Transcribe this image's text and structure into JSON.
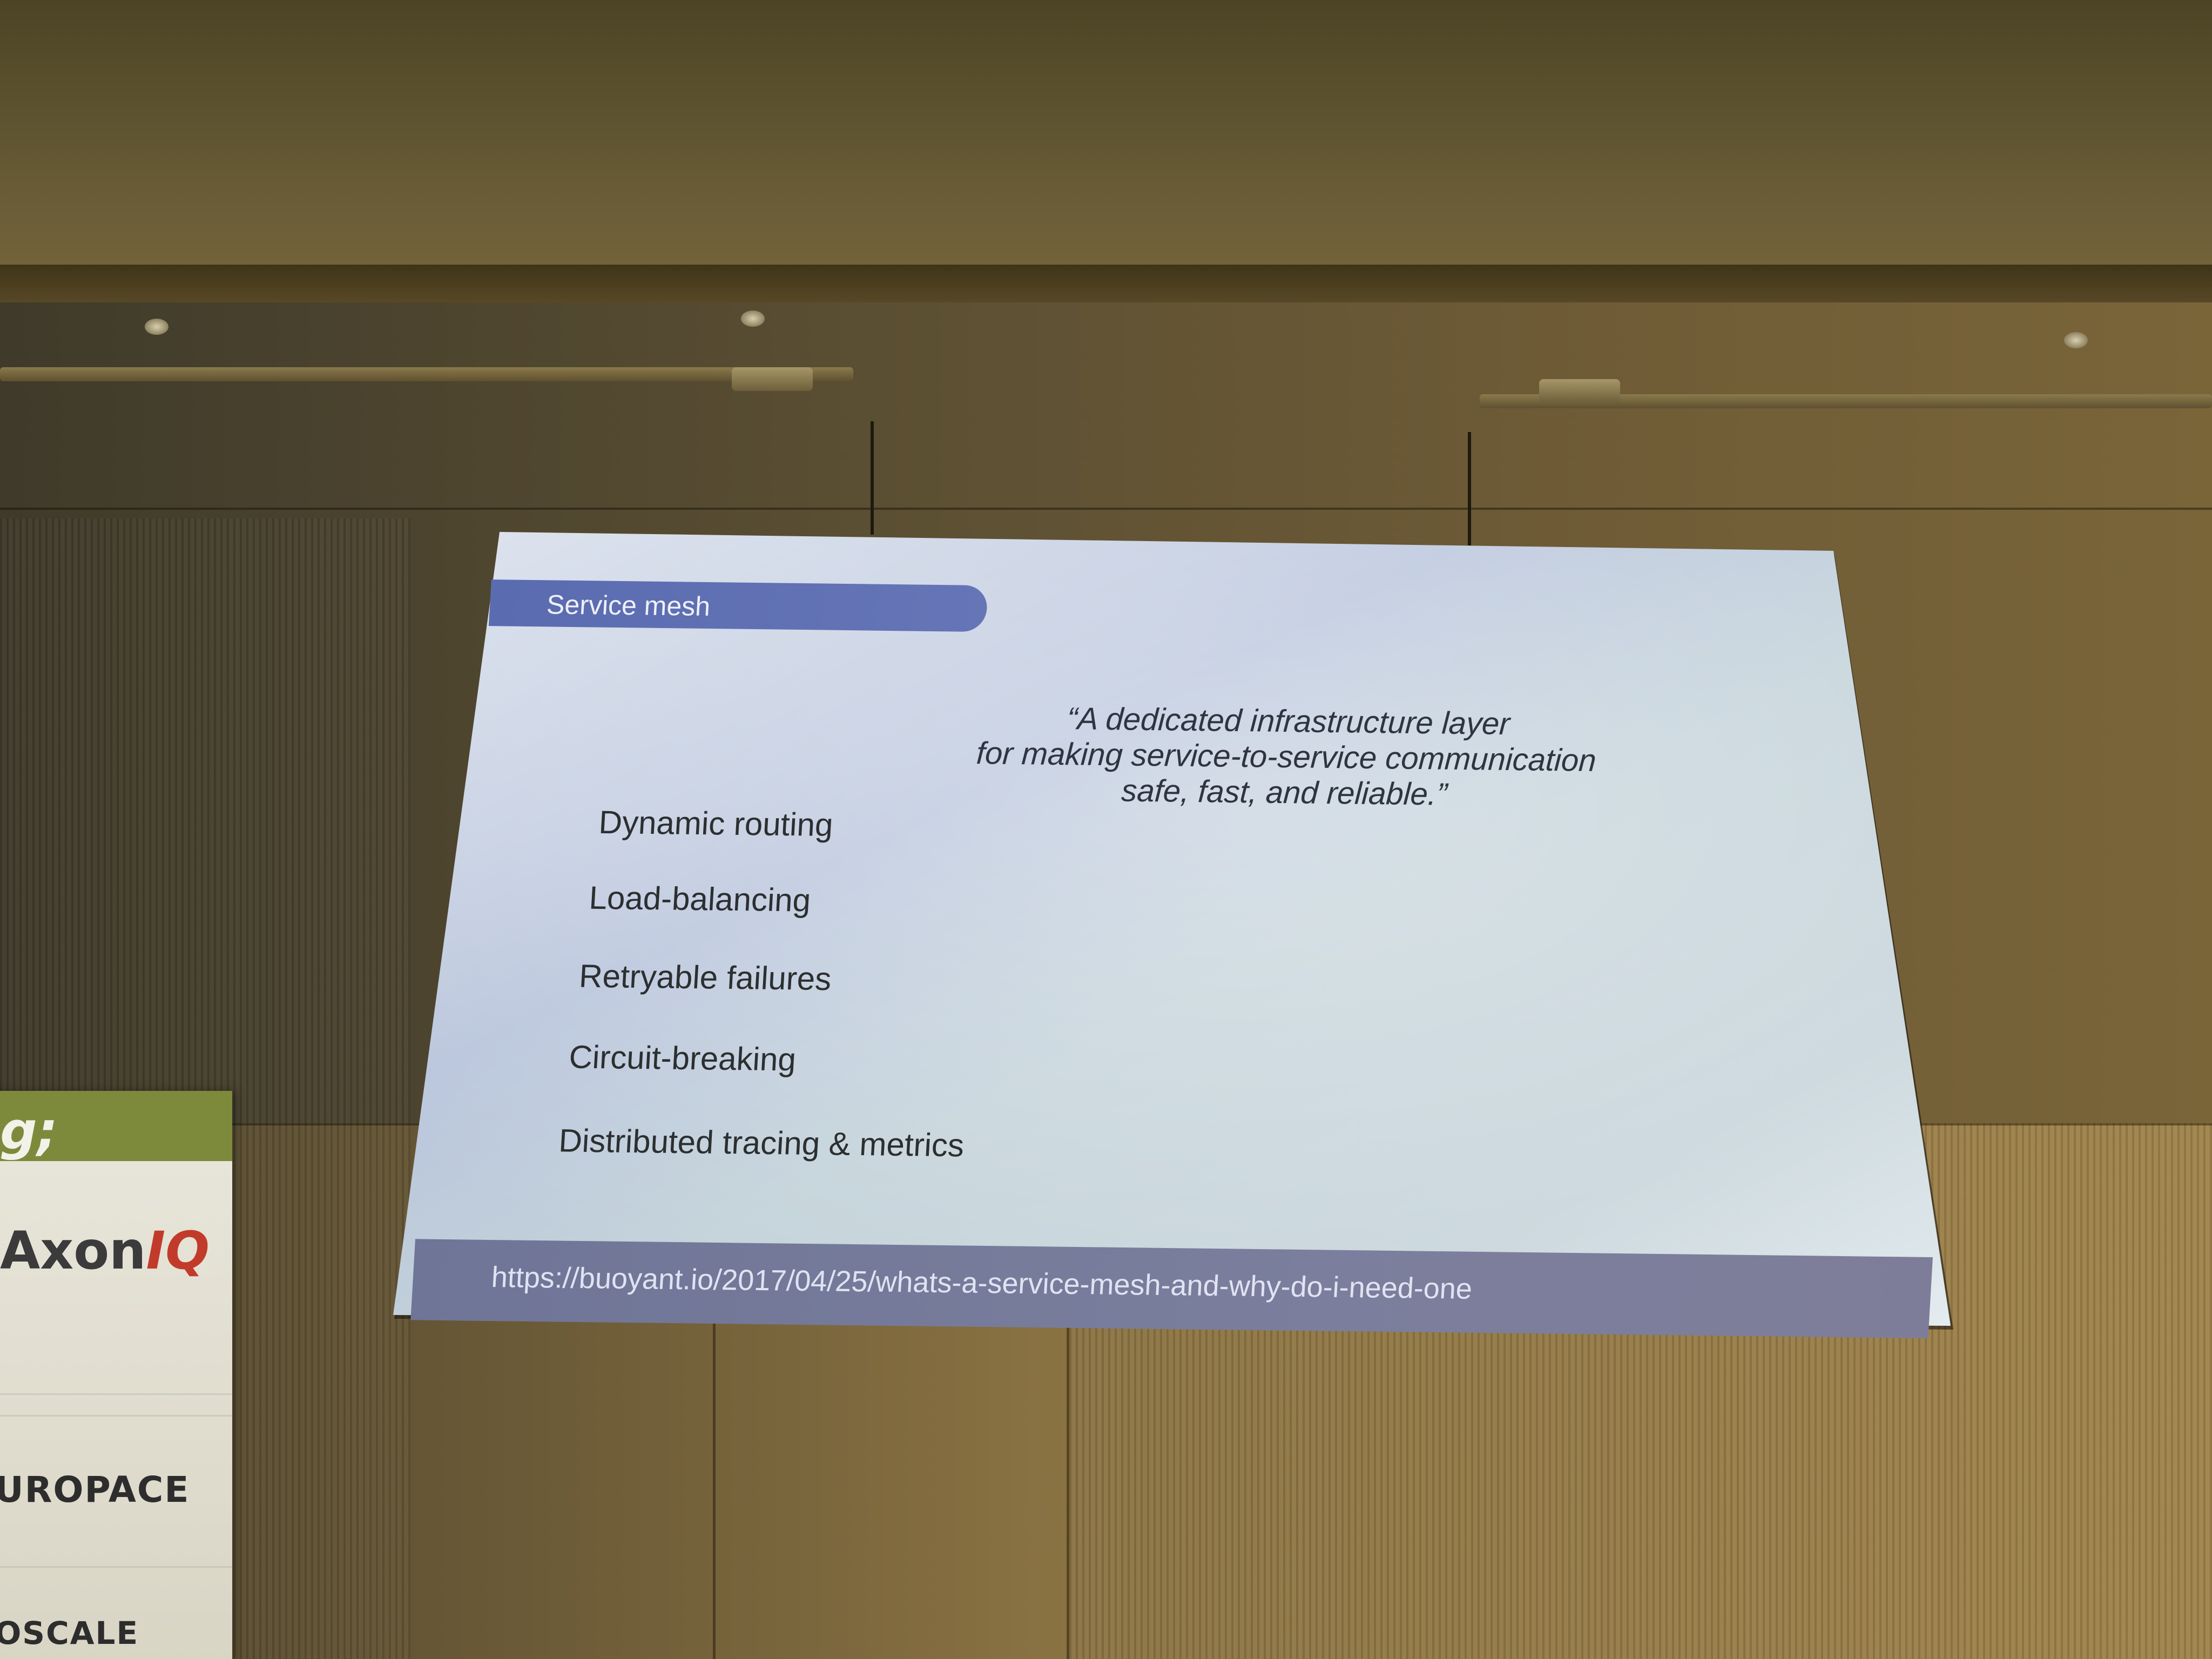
{
  "banner": {
    "top_text": "g;",
    "sponsor_axon_prefix": "Axon",
    "sponsor_axon_suffix": "IQ",
    "sponsor_europace": "UROPACE",
    "sponsor_oscale": "OSCALE"
  },
  "slide": {
    "title": "Service mesh",
    "quote_line_1": "“A dedicated infrastructure layer",
    "quote_line_2": "for making service-to-service communication",
    "quote_line_3": "safe, fast, and reliable.”",
    "bullets": [
      "Dynamic routing",
      "Load-balancing",
      "Retryable failures",
      "Circuit-breaking",
      "Distributed tracing & metrics"
    ],
    "footer_url": "https://buoyant.io/2017/04/25/whats-a-service-mesh-and-why-do-i-need-one"
  },
  "colors": {
    "title_bar": "#5a6bb0",
    "footer_bar": "#7b7f9d",
    "axon_iq_accent": "#c23b2a",
    "banner_green": "#7d8a3c"
  }
}
